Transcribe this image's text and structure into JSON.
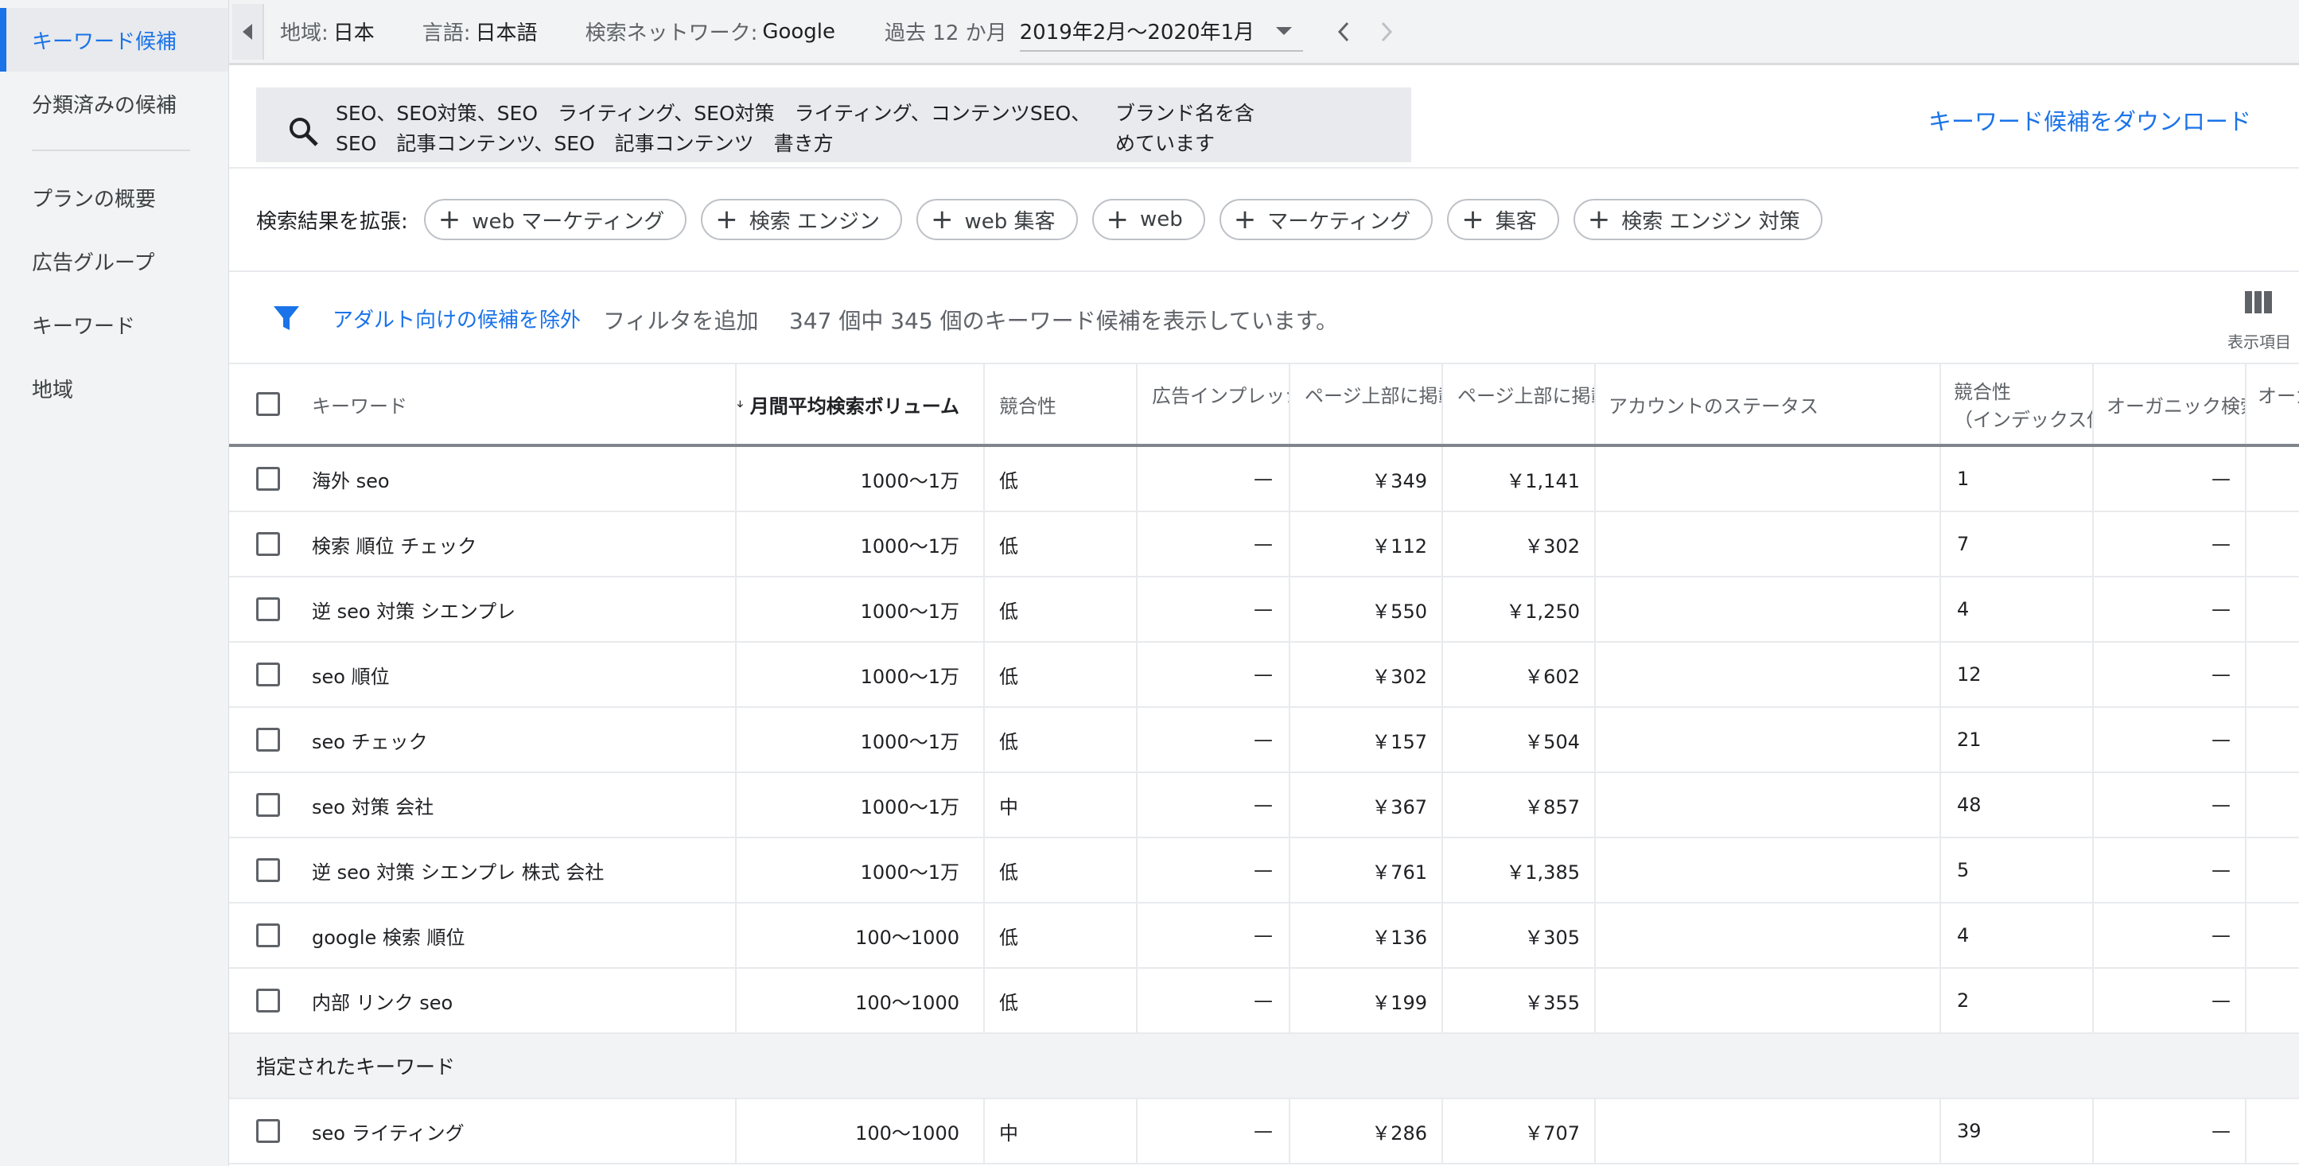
{
  "sidebar": {
    "items": [
      {
        "label": "キーワード候補",
        "active": true
      },
      {
        "label": "分類済みの候補",
        "active": false
      },
      {
        "label": "プランの概要",
        "active": false
      },
      {
        "label": "広告グループ",
        "active": false
      },
      {
        "label": "キーワード",
        "active": false
      },
      {
        "label": "地域",
        "active": false
      }
    ]
  },
  "topbar": {
    "region_label": "地域:",
    "region_value": "日本",
    "language_label": "言語:",
    "language_value": "日本語",
    "network_label": "検索ネットワーク:",
    "network_value": "Google",
    "period_label": "過去 12 か月",
    "period_value": "2019年2月〜2020年1月"
  },
  "search": {
    "query_line1": "SEO、SEO対策、SEO　ライティング、SEO対策　ライティング、コンテンツSEO、",
    "query_line2": "SEO　記事コンテンツ、SEO　記事コンテンツ　書き方",
    "brand_note_line1": "ブランド名を含",
    "brand_note_line2": "めています",
    "download_label": "キーワード候補をダウンロード"
  },
  "broaden": {
    "label": "検索結果を拡張:",
    "chips": [
      "web マーケティング",
      "検索 エンジン",
      "web 集客",
      "web",
      "マーケティング",
      "集客",
      "検索 エンジン 対策"
    ]
  },
  "filter": {
    "adult_label": "アダルト向けの候補を除外",
    "add_filter_label": "フィルタを追加",
    "result_text": "347 個中 345 個のキーワード候補を表示しています。",
    "columns_label": "表示項目"
  },
  "table": {
    "headers": {
      "keyword": "キーワード",
      "volume": "月間平均検索ボリューム",
      "competition": "競合性",
      "impression_share": "広告インプレッションシェア",
      "top_bid_low": "ページ上部に掲載された広告の入札単価（低額帯）",
      "top_bid_high": "ページ上部に掲載された広告の入札単価（高額帯）",
      "account_status": "アカウントのステータス",
      "competition_index_line1": "競合性",
      "competition_index_line2": "（インデックス値）",
      "organic": "オーガニック検索",
      "last": "オーガニック"
    },
    "rows": [
      {
        "keyword": "海外 seo",
        "volume": "1000〜1万",
        "competition": "低",
        "impression": "—",
        "low": "￥349",
        "high": "￥1,141",
        "index": "1",
        "organic": "—"
      },
      {
        "keyword": "検索 順位 チェック",
        "volume": "1000〜1万",
        "competition": "低",
        "impression": "—",
        "low": "￥112",
        "high": "￥302",
        "index": "7",
        "organic": "—"
      },
      {
        "keyword": "逆 seo 対策 シエンプレ",
        "volume": "1000〜1万",
        "competition": "低",
        "impression": "—",
        "low": "￥550",
        "high": "￥1,250",
        "index": "4",
        "organic": "—"
      },
      {
        "keyword": "seo 順位",
        "volume": "1000〜1万",
        "competition": "低",
        "impression": "—",
        "low": "￥302",
        "high": "￥602",
        "index": "12",
        "organic": "—"
      },
      {
        "keyword": "seo チェック",
        "volume": "1000〜1万",
        "competition": "低",
        "impression": "—",
        "low": "￥157",
        "high": "￥504",
        "index": "21",
        "organic": "—"
      },
      {
        "keyword": "seo 対策 会社",
        "volume": "1000〜1万",
        "competition": "中",
        "impression": "—",
        "low": "￥367",
        "high": "￥857",
        "index": "48",
        "organic": "—"
      },
      {
        "keyword": "逆 seo 対策 シエンプレ 株式 会社",
        "volume": "1000〜1万",
        "competition": "低",
        "impression": "—",
        "low": "￥761",
        "high": "￥1,385",
        "index": "5",
        "organic": "—"
      },
      {
        "keyword": "google 検索 順位",
        "volume": "100〜1000",
        "competition": "低",
        "impression": "—",
        "low": "￥136",
        "high": "￥305",
        "index": "4",
        "organic": "—"
      },
      {
        "keyword": "内部 リンク seo",
        "volume": "100〜1000",
        "competition": "低",
        "impression": "—",
        "low": "￥199",
        "high": "￥355",
        "index": "2",
        "organic": "—"
      }
    ],
    "section_label": "指定されたキーワード",
    "specified_rows": [
      {
        "keyword": "seo ライティング",
        "volume": "100〜1000",
        "competition": "中",
        "impression": "—",
        "low": "￥286",
        "high": "￥707",
        "index": "39",
        "organic": "—"
      }
    ]
  },
  "colors": {
    "accent": "#1a73e8",
    "sidebar_bg": "#f1f3f4",
    "text": "#202124",
    "muted": "#5f6368"
  }
}
